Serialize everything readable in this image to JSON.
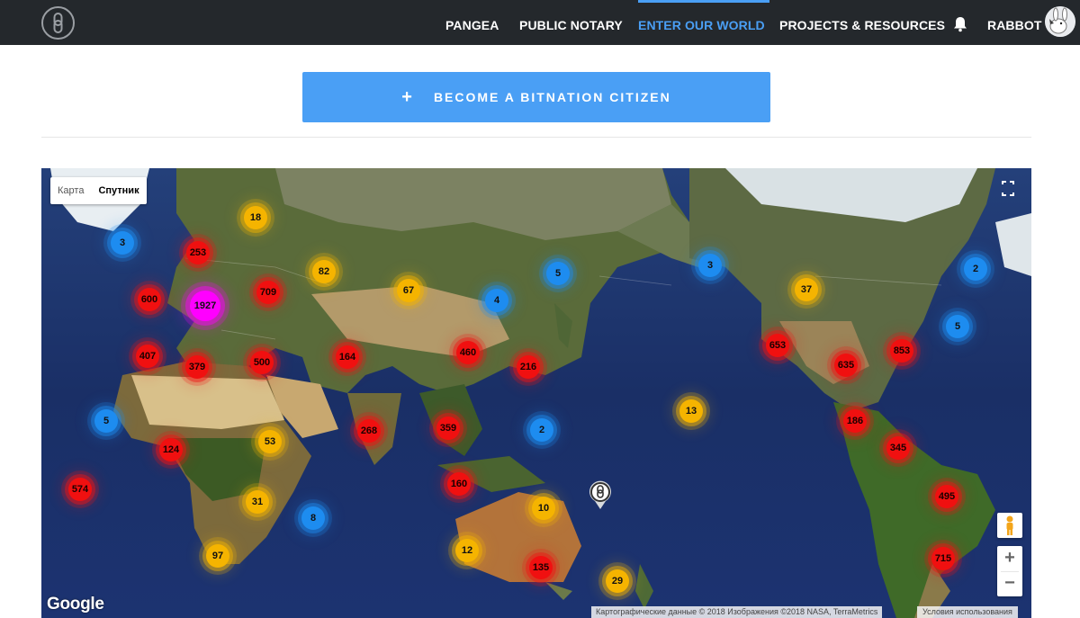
{
  "nav": {
    "items": [
      {
        "label": "PANGEA",
        "name": "nav-item-pangea",
        "active": false
      },
      {
        "label": "PUBLIC NOTARY",
        "name": "nav-item-public-notary",
        "active": false
      },
      {
        "label": "ENTER OUR WORLD",
        "name": "nav-item-enter-our-world",
        "active": true
      },
      {
        "label": "PROJECTS & RESOURCES",
        "name": "nav-item-projects-resources",
        "active": false
      }
    ],
    "user_label": "RABBOT",
    "logo_icon": "bitnation-logo-icon",
    "bell_icon": "bell-icon",
    "avatar_icon": "avatar",
    "accent_color": "#4a9ff5",
    "bar_color": "#24282c"
  },
  "cta": {
    "label": "BECOME A BITNATION CITIZEN",
    "icon": "plus-icon",
    "color": "#4a9ff5"
  },
  "map": {
    "map_type_options": [
      "Карта",
      "Спутник"
    ],
    "selected_map_type": "Спутник",
    "google_logo": "Google",
    "attribution": "Картографические данные © 2018 Изображения ©2018 NASA, TerraMetrics",
    "terms": "Условия использования",
    "zoom_in": "+",
    "zoom_out": "−",
    "clusters": [
      {
        "count": "18",
        "color": "yellow"
      },
      {
        "count": "3",
        "color": "blue"
      },
      {
        "count": "253",
        "color": "red"
      },
      {
        "count": "82",
        "color": "yellow"
      },
      {
        "count": "600",
        "color": "red"
      },
      {
        "count": "1927",
        "color": "magenta"
      },
      {
        "count": "709",
        "color": "red"
      },
      {
        "count": "67",
        "color": "yellow"
      },
      {
        "count": "4",
        "color": "blue"
      },
      {
        "count": "5",
        "color": "blue"
      },
      {
        "count": "3",
        "color": "blue"
      },
      {
        "count": "37",
        "color": "yellow"
      },
      {
        "count": "2",
        "color": "blue"
      },
      {
        "count": "5",
        "color": "blue"
      },
      {
        "count": "407",
        "color": "red"
      },
      {
        "count": "379",
        "color": "red"
      },
      {
        "count": "500",
        "color": "red"
      },
      {
        "count": "164",
        "color": "red"
      },
      {
        "count": "460",
        "color": "red"
      },
      {
        "count": "216",
        "color": "red"
      },
      {
        "count": "653",
        "color": "red"
      },
      {
        "count": "635",
        "color": "red"
      },
      {
        "count": "853",
        "color": "red"
      },
      {
        "count": "5",
        "color": "blue"
      },
      {
        "count": "13",
        "color": "yellow"
      },
      {
        "count": "186",
        "color": "red"
      },
      {
        "count": "124",
        "color": "red"
      },
      {
        "count": "53",
        "color": "yellow"
      },
      {
        "count": "268",
        "color": "red"
      },
      {
        "count": "359",
        "color": "red"
      },
      {
        "count": "2",
        "color": "blue"
      },
      {
        "count": "345",
        "color": "red"
      },
      {
        "count": "574",
        "color": "red"
      },
      {
        "count": "160",
        "color": "red"
      },
      {
        "count": "31",
        "color": "yellow"
      },
      {
        "count": "495",
        "color": "red"
      },
      {
        "count": "8",
        "color": "blue"
      },
      {
        "count": "10",
        "color": "yellow"
      },
      {
        "count": "97",
        "color": "yellow"
      },
      {
        "count": "12",
        "color": "yellow"
      },
      {
        "count": "135",
        "color": "red"
      },
      {
        "count": "29",
        "color": "yellow"
      },
      {
        "count": "715",
        "color": "red"
      }
    ],
    "colors": {
      "red": "#f01010",
      "yellow": "#f5b400",
      "blue": "#1d8cf0",
      "magenta": "#ff00ff"
    }
  }
}
